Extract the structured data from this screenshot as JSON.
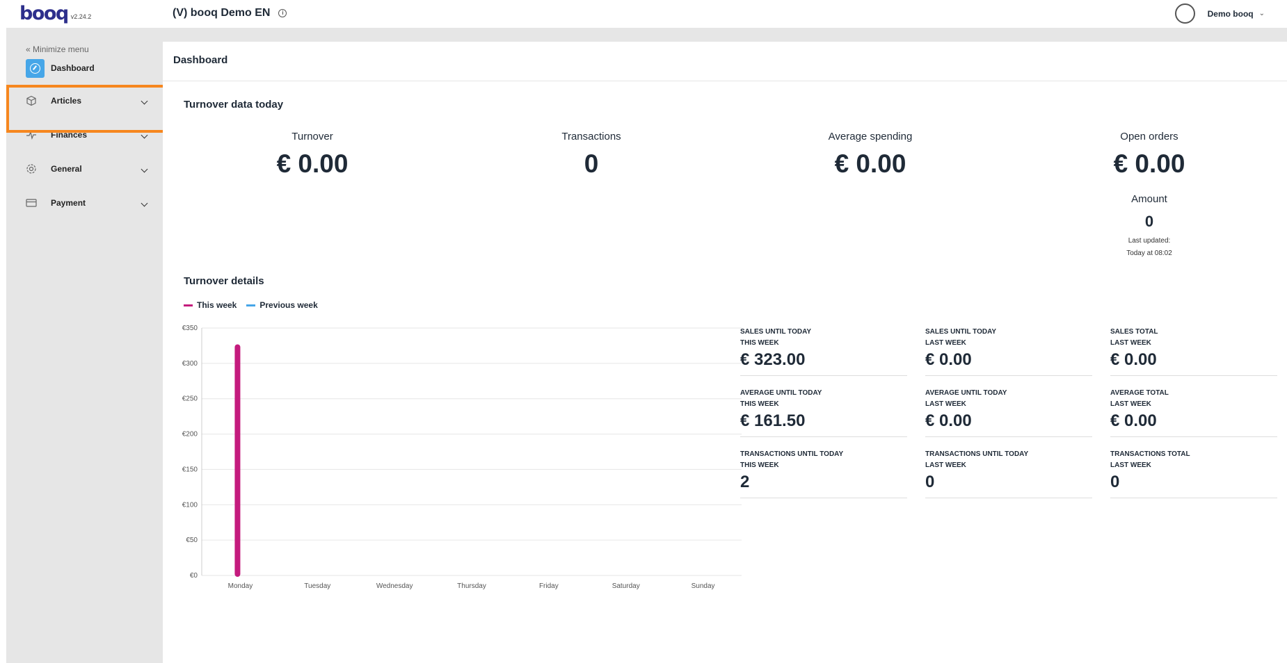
{
  "app": {
    "logo_text": "booq",
    "version": "v2.24.2",
    "venue": "(V) booq Demo EN",
    "username": "Demo booq"
  },
  "colors": {
    "logo": "#2d2f8c",
    "logo_accent": "#e94e6f",
    "sidebar_bg": "#e6e6e6",
    "dashboard_icon": "#46a6e8",
    "highlight": "#f6871f",
    "this_week": "#c41b7d",
    "previous_week": "#46a6e8"
  },
  "sidebar": {
    "minimize_label": "Minimize menu",
    "items": [
      {
        "label": "Dashboard",
        "icon": "compass-icon"
      },
      {
        "label": "Articles",
        "icon": "cube-icon"
      },
      {
        "label": "Finances",
        "icon": "pulse-icon"
      },
      {
        "label": "General",
        "icon": "gear-icon"
      },
      {
        "label": "Payment",
        "icon": "card-icon"
      }
    ]
  },
  "page": {
    "title": "Dashboard",
    "turnover_today_title": "Turnover data today",
    "kpis": [
      {
        "label": "Turnover",
        "value": "€ 0.00"
      },
      {
        "label": "Transactions",
        "value": "0"
      },
      {
        "label": "Average spending",
        "value": "€ 0.00"
      },
      {
        "label": "Open orders",
        "value": "€ 0.00"
      }
    ],
    "amount_label": "Amount",
    "amount_value": "0",
    "last_updated_label": "Last updated:",
    "last_updated_value": "Today at 08:02",
    "turnover_details_title": "Turnover details",
    "legend": {
      "this_week": "This week",
      "previous_week": "Previous week"
    }
  },
  "chart_data": {
    "type": "bar",
    "categories": [
      "Monday",
      "Tuesday",
      "Wednesday",
      "Thursday",
      "Friday",
      "Saturday",
      "Sunday"
    ],
    "series": [
      {
        "name": "This week",
        "values": [
          323,
          0,
          0,
          0,
          0,
          0,
          0
        ]
      },
      {
        "name": "Previous week",
        "values": [
          0,
          0,
          0,
          0,
          0,
          0,
          0
        ]
      }
    ],
    "yticks": [
      "€0",
      "€50",
      "€100",
      "€150",
      "€200",
      "€250",
      "€300",
      "€350"
    ],
    "ylim": [
      0,
      350
    ],
    "grid": true,
    "legend_position": "top-left"
  },
  "stats": [
    {
      "line1": "SALES UNTIL TODAY",
      "line2": "THIS WEEK",
      "value": "€ 323.00"
    },
    {
      "line1": "SALES UNTIL TODAY",
      "line2": "LAST WEEK",
      "value": "€ 0.00"
    },
    {
      "line1": "SALES TOTAL",
      "line2": "LAST WEEK",
      "value": "€ 0.00"
    },
    {
      "line1": "AVERAGE UNTIL TODAY",
      "line2": "THIS WEEK",
      "value": "€ 161.50"
    },
    {
      "line1": "AVERAGE UNTIL TODAY",
      "line2": "LAST WEEK",
      "value": "€ 0.00"
    },
    {
      "line1": "AVERAGE TOTAL",
      "line2": "LAST WEEK",
      "value": "€ 0.00"
    },
    {
      "line1": "TRANSACTIONS UNTIL TODAY",
      "line2": "THIS WEEK",
      "value": "2"
    },
    {
      "line1": "TRANSACTIONS UNTIL TODAY",
      "line2": "LAST WEEK",
      "value": "0"
    },
    {
      "line1": "TRANSACTIONS TOTAL",
      "line2": "LAST WEEK",
      "value": "0"
    }
  ]
}
